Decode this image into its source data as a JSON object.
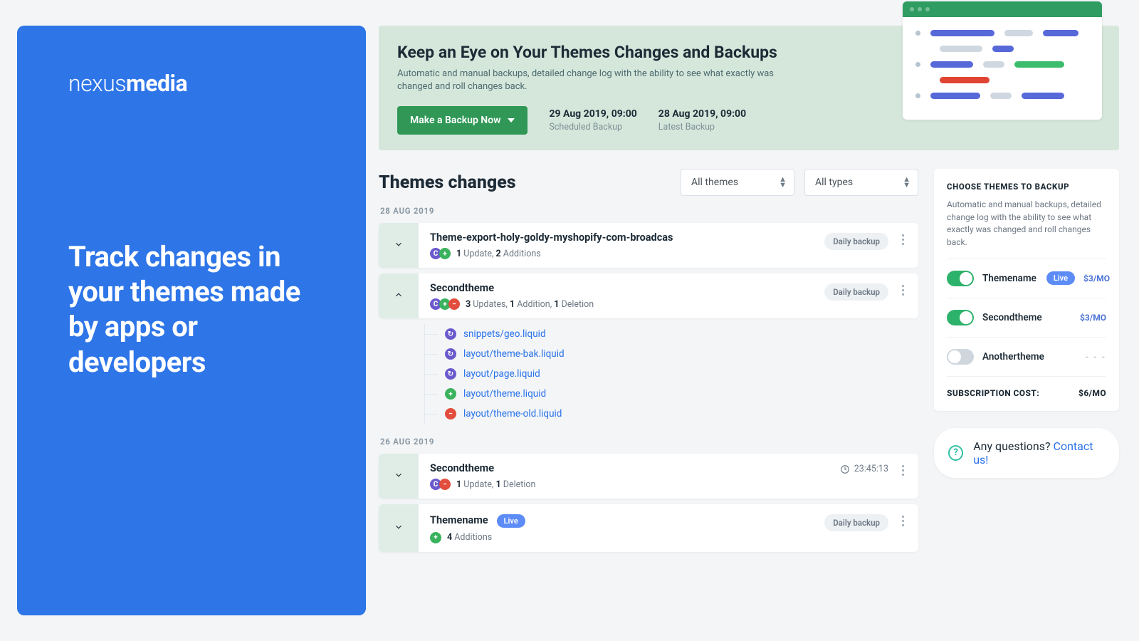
{
  "promo": {
    "brand_light": "nexus",
    "brand_bold": "media",
    "copy": "Track changes in your themes made by apps or developers"
  },
  "banner": {
    "title": "Keep an Eye on Your Themes Changes and Backups",
    "subtitle": "Automatic and manual backups, detailed change log with the ability to see what exactly was changed and roll changes back.",
    "cta": "Make a Backup Now",
    "scheduled": {
      "datetime": "29 Aug 2019, 09:00",
      "label": "Scheduled Backup"
    },
    "latest": {
      "datetime": "28 Aug 2019, 09:00",
      "label": "Latest Backup"
    }
  },
  "main": {
    "title": "Themes changes",
    "filter_themes": "All themes",
    "filter_types": "All types",
    "groups": {
      "g0": {
        "date": "28 AUG 2019",
        "i0": {
          "name": "Theme-export-holy-goldy-myshopify-com-broadcas",
          "stats": "1 Update, 2 Additions",
          "pieces": {
            "u": "1",
            "u_lbl": " Update, ",
            "a": "2",
            "a_lbl": " Additions"
          },
          "badge": "Daily backup"
        },
        "i1": {
          "name": "Secondtheme",
          "stats": "3 Updates, 1 Addition, 1 Deletion",
          "pieces": {
            "u": "3",
            "u_lbl": " Updates, ",
            "a": "1",
            "a_lbl": " Addition, ",
            "d": "1",
            "d_lbl": " Deletion"
          },
          "badge": "Daily backup",
          "files": {
            "f0": {
              "kind": "upd",
              "path": "snippets/geo.liquid"
            },
            "f1": {
              "kind": "upd",
              "path": "layout/theme-bak.liquid"
            },
            "f2": {
              "kind": "upd",
              "path": "layout/page.liquid"
            },
            "f3": {
              "kind": "add",
              "path": "layout/theme.liquid"
            },
            "f4": {
              "kind": "del",
              "path": "layout/theme-old.liquid"
            }
          }
        }
      },
      "g1": {
        "date": "26 AUG 2019",
        "i0": {
          "name": "Secondtheme",
          "stats": "1 Update, 1 Deletion",
          "pieces": {
            "u": "1",
            "u_lbl": " Update, ",
            "d": "1",
            "d_lbl": " Deletion"
          },
          "time": "23:45:13"
        },
        "i1": {
          "name": "Themename",
          "live": "Live",
          "stats": "4 Additions",
          "pieces": {
            "a": "4",
            "a_lbl": " Additions"
          },
          "badge": "Daily backup"
        }
      }
    }
  },
  "sidebar": {
    "heading": "CHOOSE THEMES TO BACKUP",
    "text": "Automatic and manual backups, detailed change log  with the ability to see what exactly was changed and roll changes back.",
    "opts": {
      "o0": {
        "name": "Themename",
        "live": "Live",
        "price": "$3/MO",
        "on": true
      },
      "o1": {
        "name": "Secondtheme",
        "price": "$3/MO",
        "on": true
      },
      "o2": {
        "name": "Anothertheme",
        "price": "- - -",
        "on": false
      }
    },
    "cost_label": "SUBSCRIPTION COST:",
    "cost_value": "$6/MO"
  },
  "help": {
    "q": "Any questions? ",
    "link": "Contact us!"
  }
}
